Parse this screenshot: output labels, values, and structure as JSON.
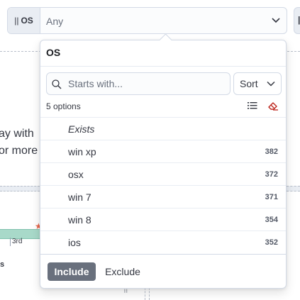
{
  "filter": {
    "field_label": "OS",
    "value": "Any"
  },
  "background": {
    "text_line1": "ay with",
    "text_line2": "or more",
    "tick_label": "3rd",
    "bottom_label": "s"
  },
  "popover": {
    "title": "OS",
    "search_placeholder": "Starts with...",
    "sort_label": "Sort",
    "options_count": "5 options",
    "options": [
      {
        "label": "Exists",
        "count": ""
      },
      {
        "label": "win xp",
        "count": "382"
      },
      {
        "label": "osx",
        "count": "372"
      },
      {
        "label": "win 7",
        "count": "371"
      },
      {
        "label": "win 8",
        "count": "354"
      },
      {
        "label": "ios",
        "count": "352"
      }
    ],
    "include_label": "Include",
    "exclude_label": "Exclude"
  },
  "colors": {
    "include_bg": "#69707d",
    "eraser": "#bd271e",
    "chart_fill": "#a8d9c9"
  }
}
